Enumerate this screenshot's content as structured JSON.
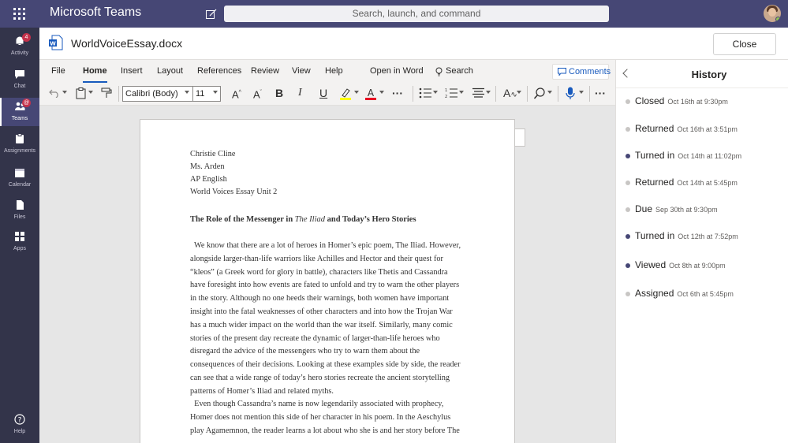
{
  "topbar": {
    "app_title": "Microsoft Teams",
    "search_placeholder": "Search, launch, and command"
  },
  "rail": {
    "items": [
      {
        "label": "Activity",
        "badge": "4"
      },
      {
        "label": "Chat"
      },
      {
        "label": "Teams",
        "badge": "@"
      },
      {
        "label": "Assignments"
      },
      {
        "label": "Calendar"
      },
      {
        "label": "Files"
      },
      {
        "label": "Apps"
      },
      {
        "label": "Help"
      }
    ]
  },
  "document": {
    "name": "WorldVoiceEssay.docx",
    "close_label": "Close"
  },
  "ribbon": {
    "tabs": [
      "File",
      "Home",
      "Insert",
      "Layout",
      "References",
      "Review",
      "View",
      "Help",
      "Open in Word",
      "Search"
    ],
    "active_tab": "Home",
    "comments_label": "Comments",
    "font_name": "Calibri (Body)",
    "font_size": "11",
    "colors": {
      "highlight": "#ffff00",
      "font_color": "#e81123",
      "accent": "#185abd"
    }
  },
  "essay": {
    "header_lines": [
      "Christie Cline",
      "Ms. Arden",
      "AP English",
      "World Voices Essay Unit 2"
    ],
    "title_before": "The Role of the Messenger in ",
    "title_italic": "The Iliad",
    "title_after": " and Today’s Hero Stories",
    "para1_lines": [
      "  We know that there are a lot of heroes in Homer’s epic poem, The Iliad. However,",
      "alongside larger-than-life warriors like Achilles and Hector and their quest for",
      "“kleos” (a Greek word for glory in battle), characters like Thetis and Cassandra",
      "have foresight into how events are fated to unfold and try to warn the other players",
      "in the story. Although no one heeds their warnings, both women have important",
      "insight into the fatal weaknesses of other characters and into how the Trojan War",
      "has a much wider impact on the world than the war itself. Similarly, many comic",
      "stories of the present day recreate the dynamic of larger-than-life heroes who",
      "disregard the advice of the messengers who try to warn them about the",
      "consequences of their decisions. Looking at these examples side by side, the reader",
      "can see that a wide range of today’s hero stories recreate the ancient storytelling",
      "patterns of Homer’s Iliad and related myths."
    ],
    "para2_lines": [
      "  Even though Cassandra’s name is now legendarily associated with prophecy,",
      "Homer does not mention this side of her character in his poem. In the Aeschylus",
      "play Agamemnon, the reader learns a lot about who she is and her story before The"
    ]
  },
  "history": {
    "title": "History",
    "events": [
      {
        "status": "Closed",
        "time": "Oct 16th at 9:30pm",
        "filled": false
      },
      {
        "status": "Returned",
        "time": "Oct 16th at 3:51pm",
        "filled": false
      },
      {
        "status": "Turned in",
        "time": "Oct 14th at 11:02pm",
        "filled": true
      },
      {
        "status": "Returned",
        "time": "Oct 14th at 5:45pm",
        "filled": false
      },
      {
        "status": "Due",
        "time": "Sep 30th at 9:30pm",
        "filled": false
      },
      {
        "status": "Turned in",
        "time": "Oct 12th at 7:52pm",
        "filled": true
      },
      {
        "status": "Viewed",
        "time": "Oct 8th at 9:00pm",
        "filled": true
      },
      {
        "status": "Assigned",
        "time": "Oct 6th at 5:45pm",
        "filled": false
      }
    ]
  }
}
